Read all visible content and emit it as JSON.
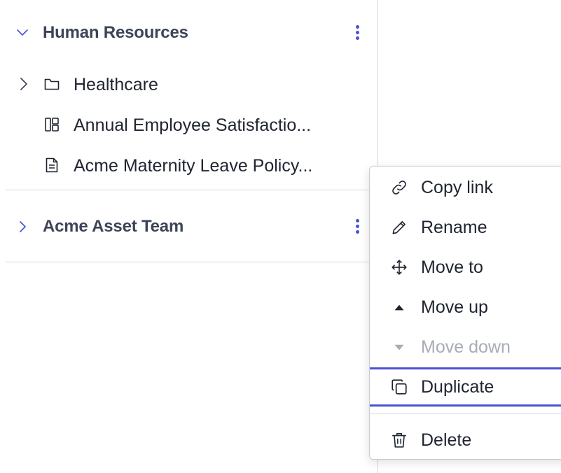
{
  "sidebar": {
    "sections": [
      {
        "title": "Human Resources",
        "expanded": true,
        "toggle_icon": "chevron-down-icon",
        "more_icon": "kebab-menu-icon"
      },
      {
        "title": "Acme Asset Team",
        "expanded": false,
        "toggle_icon": "chevron-right-icon",
        "more_icon": "kebab-menu-icon"
      }
    ],
    "items": [
      {
        "label": "Healthcare",
        "icon": "folder-icon",
        "expand_icon": "chevron-right-icon"
      },
      {
        "label": "Annual Employee Satisfactio...",
        "icon": "dashboard-icon"
      },
      {
        "label": "Acme Maternity Leave Policy...",
        "icon": "document-icon"
      }
    ]
  },
  "context_menu": {
    "items": [
      {
        "label": "Copy link",
        "icon": "link-icon",
        "enabled": true
      },
      {
        "label": "Rename",
        "icon": "pencil-icon",
        "enabled": true
      },
      {
        "label": "Move to",
        "icon": "move-arrows-icon",
        "enabled": true
      },
      {
        "label": "Move up",
        "icon": "triangle-up-icon",
        "enabled": true
      },
      {
        "label": "Move down",
        "icon": "triangle-down-icon",
        "enabled": false
      },
      {
        "label": "Duplicate",
        "icon": "duplicate-icon",
        "enabled": true,
        "focused": true
      },
      {
        "label": "Delete",
        "icon": "trash-icon",
        "enabled": true
      }
    ]
  },
  "colors": {
    "accent": "#4a51d6",
    "heading": "#3d4457",
    "text": "#1f2430",
    "disabled": "#a8acb5",
    "border": "#d4d7de"
  }
}
